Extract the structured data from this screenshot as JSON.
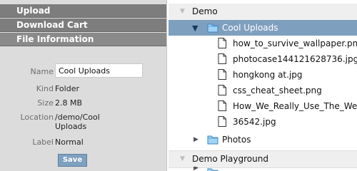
{
  "sidebar": {
    "sections": {
      "upload": "Upload",
      "download": "Download Cart",
      "file_info": "File Information"
    },
    "properties": {
      "name_label": "Name",
      "name_value": "Cool Uploads",
      "kind_label": "Kind",
      "kind_value": "Folder",
      "size_label": "Size",
      "size_value": "2.8 MB",
      "location_label": "Location",
      "location_line1": "/demo/Cool",
      "location_line2": "Uploads",
      "label_label": "Label",
      "label_value": "Normal"
    },
    "save_label": "Save"
  },
  "tree": {
    "root": "Demo",
    "selected_folder": "Cool Uploads",
    "files": [
      "how_to_survive_wallpaper.png",
      "photocase144121628736.jpg",
      "hongkong at.jpg",
      "css_cheat_sheet.png",
      "How_We_Really_Use_The_Web",
      "36542.jpg"
    ],
    "photos_folder": "Photos",
    "playground": "Demo Playground"
  },
  "colors": {
    "header_bg": "#7d7d7d",
    "selection_bg": "#7f9fbf",
    "button_bg": "#7fa0bf",
    "sidebar_bg": "#dcdcdc"
  }
}
